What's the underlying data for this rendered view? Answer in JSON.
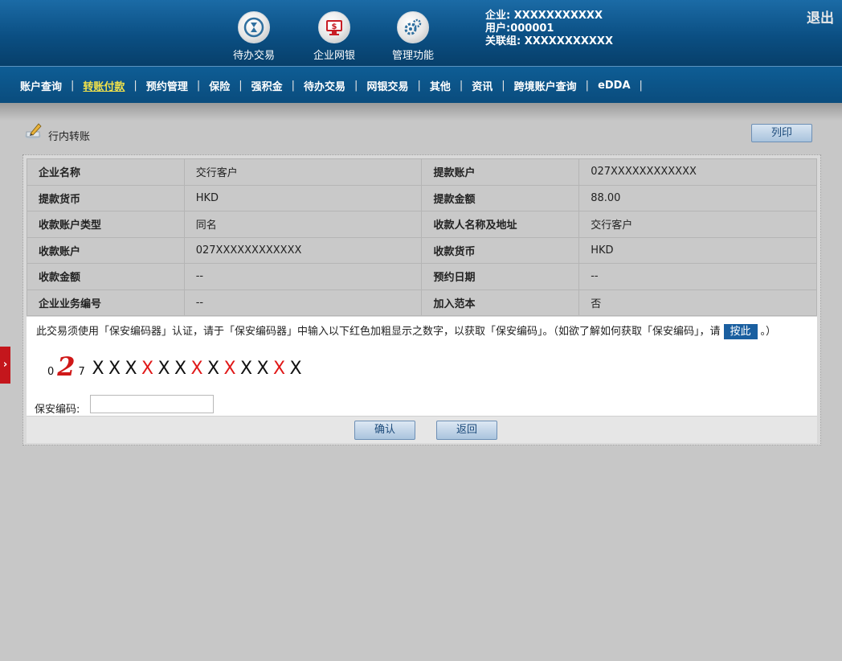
{
  "header": {
    "icons": [
      {
        "label": "待办交易",
        "icon": "hourglass-icon"
      },
      {
        "label": "企业网银",
        "icon": "monitor-dollar-icon"
      },
      {
        "label": "管理功能",
        "icon": "gears-icon"
      }
    ],
    "user": {
      "company": "企业: XXXXXXXXXXX",
      "user": "用户:000001",
      "group": "关联组: XXXXXXXXXXX"
    },
    "logout": "退出"
  },
  "nav": {
    "items": [
      "账户查询",
      "转账付款",
      "预约管理",
      "保险",
      "强积金",
      "待办交易",
      "网银交易",
      "其他",
      "资讯",
      "跨境账户查询",
      "eDDA"
    ],
    "active": "转账付款"
  },
  "page": {
    "title": "行内转账",
    "print_button": "列印"
  },
  "details": {
    "rows": [
      {
        "l1": "企业名称",
        "v1": "交行客户",
        "l2": "提款账户",
        "v2": "027XXXXXXXXXXXX"
      },
      {
        "l1": "提款货币",
        "v1": "HKD",
        "l2": "提款金额",
        "v2": "88.00"
      },
      {
        "l1": "收款账户类型",
        "v1": "同名",
        "l2": "收款人名称及地址",
        "v2": "交行客户"
      },
      {
        "l1": "收款账户",
        "v1": "027XXXXXXXXXXXX",
        "l2": "收款货币",
        "v2": "HKD"
      },
      {
        "l1": "收款金额",
        "v1": "--",
        "l2": "预约日期",
        "v2": "--"
      },
      {
        "l1": "企业业务编号",
        "v1": "--",
        "l2": "加入范本",
        "v2": "否"
      }
    ]
  },
  "token": {
    "message_before": "此交易须使用「保安编码器」认证，请于「保安编码器」中输入以下红色加粗显示之数字，以获取「保安编码」。（如欲了解如何获取「保安编码」，请",
    "link_label": "按此",
    "message_after": "。）",
    "digit_prefix_1": "0",
    "digit_highlight": "2",
    "digit_prefix_2": "7",
    "digit_sequence": [
      {
        "ch": "X",
        "red": false
      },
      {
        "ch": "X",
        "red": false
      },
      {
        "ch": "X",
        "red": false
      },
      {
        "ch": "X",
        "red": true
      },
      {
        "ch": "X",
        "red": false
      },
      {
        "ch": "X",
        "red": false
      },
      {
        "ch": "X",
        "red": true
      },
      {
        "ch": "X",
        "red": false
      },
      {
        "ch": "X",
        "red": true
      },
      {
        "ch": "X",
        "red": false
      },
      {
        "ch": "X",
        "red": false
      },
      {
        "ch": "X",
        "red": true
      },
      {
        "ch": "X",
        "red": false
      }
    ],
    "code_label": "保安编码:",
    "code_value": ""
  },
  "actions": {
    "confirm": "确认",
    "back": "返回"
  },
  "side_tab": "›"
}
